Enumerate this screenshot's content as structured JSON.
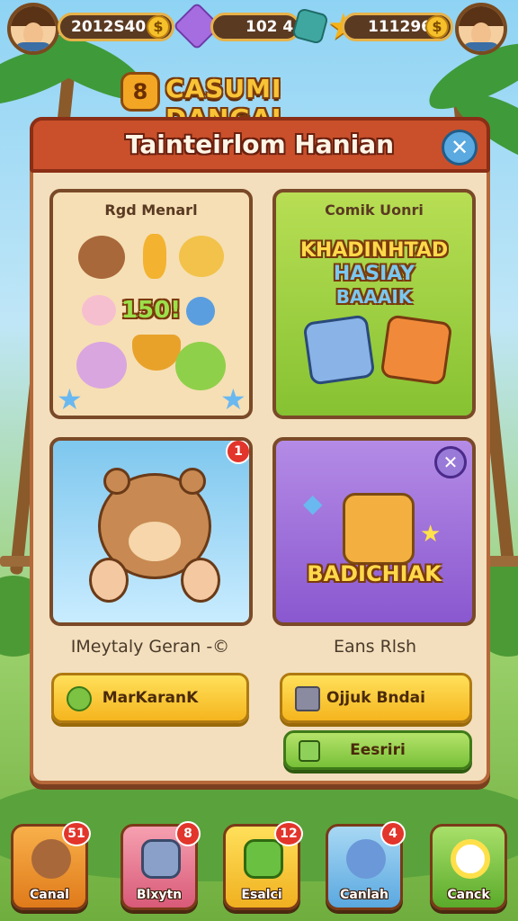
{
  "header": {
    "left_currency": "2012S40",
    "mid_currency": "102 4",
    "right_currency": "111296",
    "coin_symbol": "$"
  },
  "logo": {
    "badge": "8",
    "title": "CASUMI DANGAI"
  },
  "panel": {
    "title": "Tainteirlom Hanian",
    "close_symbol": "✕"
  },
  "cards": [
    {
      "title": "Rgd Menarl",
      "number": "150!"
    },
    {
      "title": "Comik Uonri",
      "headline_line1": "KHADINHTAD",
      "headline_line2": "HASIAY",
      "headline_line3": "BAAAIK"
    },
    {
      "badge": "1"
    },
    {
      "headline": "BADICHIAK"
    }
  ],
  "captions": {
    "left": "IMeytaly Geran -©",
    "right": "Eans Rlsh"
  },
  "buttons": {
    "left": "MarKaranK",
    "right": "Ojjuk Bndai",
    "green": "Eesriri"
  },
  "bottom_nav": [
    {
      "label": "Canal",
      "badge": "51"
    },
    {
      "label": "Blxytn",
      "badge": "8"
    },
    {
      "label": "Esalci",
      "badge": "12"
    },
    {
      "label": "Canlah",
      "badge": "4"
    },
    {
      "label": "Canck"
    }
  ],
  "colors": {
    "panel_header": "#c9502b",
    "button_yellow": "#f5b51e",
    "button_green": "#78c038",
    "badge_red": "#e2352b"
  }
}
